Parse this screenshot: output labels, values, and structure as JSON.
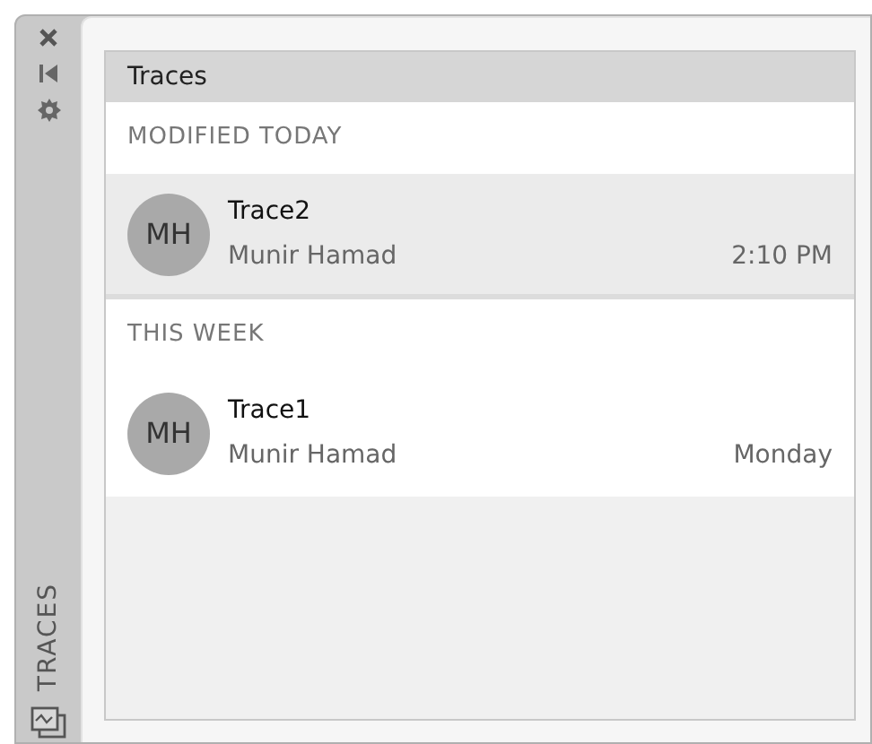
{
  "side_tab": {
    "label": "TRACES"
  },
  "panel": {
    "title": "Traces"
  },
  "groups": [
    {
      "heading": "MODIFIED TODAY",
      "items": [
        {
          "initials": "MH",
          "name": "Trace2",
          "author": "Munir Hamad",
          "time": "2:10 PM",
          "selected": true
        }
      ]
    },
    {
      "heading": "THIS WEEK",
      "items": [
        {
          "initials": "MH",
          "name": "Trace1",
          "author": "Munir Hamad",
          "time": "Monday",
          "selected": false
        }
      ]
    }
  ]
}
